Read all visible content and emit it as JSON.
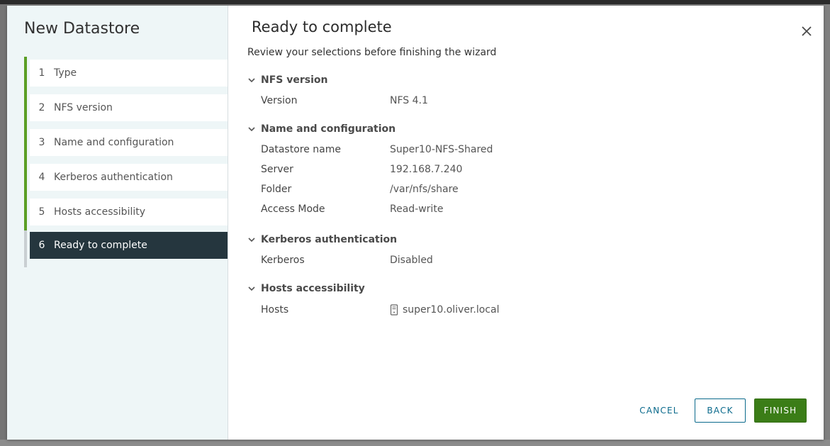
{
  "wizard": {
    "title": "New Datastore",
    "steps": [
      {
        "num": "1",
        "label": "Type"
      },
      {
        "num": "2",
        "label": "NFS version"
      },
      {
        "num": "3",
        "label": "Name and configuration"
      },
      {
        "num": "4",
        "label": "Kerberos authentication"
      },
      {
        "num": "5",
        "label": "Hosts accessibility"
      },
      {
        "num": "6",
        "label": "Ready to complete"
      }
    ],
    "active_step": 6
  },
  "page": {
    "title": "Ready to complete",
    "subtitle": "Review your selections before finishing the wizard"
  },
  "sections": [
    {
      "title": "NFS version",
      "rows": [
        {
          "key": "Version",
          "value": "NFS 4.1"
        }
      ]
    },
    {
      "title": "Name and configuration",
      "rows": [
        {
          "key": "Datastore name",
          "value": "Super10-NFS-Shared"
        },
        {
          "key": "Server",
          "value": "192.168.7.240"
        },
        {
          "key": "Folder",
          "value": "/var/nfs/share"
        },
        {
          "key": "Access Mode",
          "value": "Read-write"
        }
      ]
    },
    {
      "title": "Kerberos authentication",
      "rows": [
        {
          "key": "Kerberos",
          "value": "Disabled"
        }
      ]
    },
    {
      "title": "Hosts accessibility",
      "rows": [
        {
          "key": "Hosts",
          "value": "super10.oliver.local",
          "icon": "host-icon"
        }
      ]
    }
  ],
  "footer": {
    "cancel_label": "CANCEL",
    "back_label": "BACK",
    "finish_label": "FINISH"
  },
  "colors": {
    "accent_green": "#5a9e25",
    "active_step_bg": "#25363e",
    "link_blue": "#0b6a8c",
    "finish_bg": "#3b7d17"
  }
}
